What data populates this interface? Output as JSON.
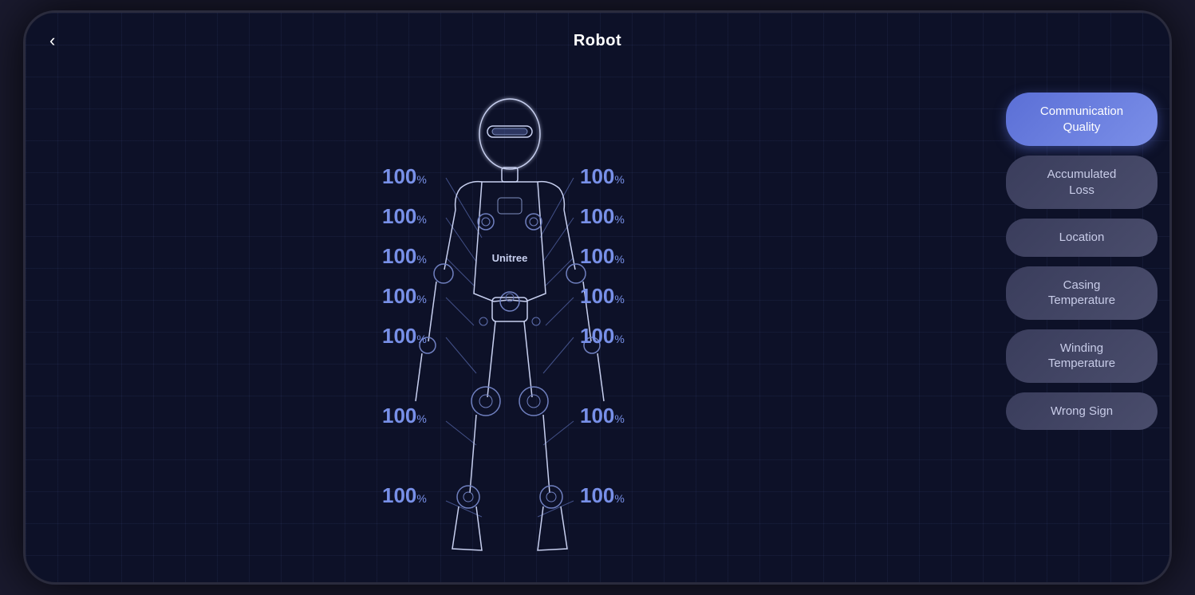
{
  "header": {
    "title": "Robot",
    "back_label": "‹"
  },
  "sidebar": {
    "buttons": [
      {
        "label": "Communication\nQuality",
        "active": true,
        "id": "communication-quality"
      },
      {
        "label": "Accumulated\nLoss",
        "active": false,
        "id": "accumulated-loss"
      },
      {
        "label": "Location",
        "active": false,
        "id": "location"
      },
      {
        "label": "Casing\nTemperature",
        "active": false,
        "id": "casing-temperature"
      },
      {
        "label": "Winding\nTemperature",
        "active": false,
        "id": "winding-temperature"
      },
      {
        "label": "Wrong Sign",
        "active": false,
        "id": "wrong-sign"
      }
    ]
  },
  "robot": {
    "brand_label": "Unitree",
    "left_values": [
      "100",
      "100",
      "100",
      "100",
      "100",
      "100",
      "100"
    ],
    "right_values": [
      "100",
      "100",
      "100",
      "100",
      "100",
      "100",
      "100"
    ]
  },
  "colors": {
    "active_btn_from": "#5b6fd6",
    "active_btn_to": "#7b8fe8",
    "inactive_btn_from": "#3a3d5c",
    "inactive_btn_to": "#4a4d6c",
    "accent": "#7890e8",
    "background": "#0d1128",
    "grid": "rgba(100,120,200,0.08)"
  }
}
